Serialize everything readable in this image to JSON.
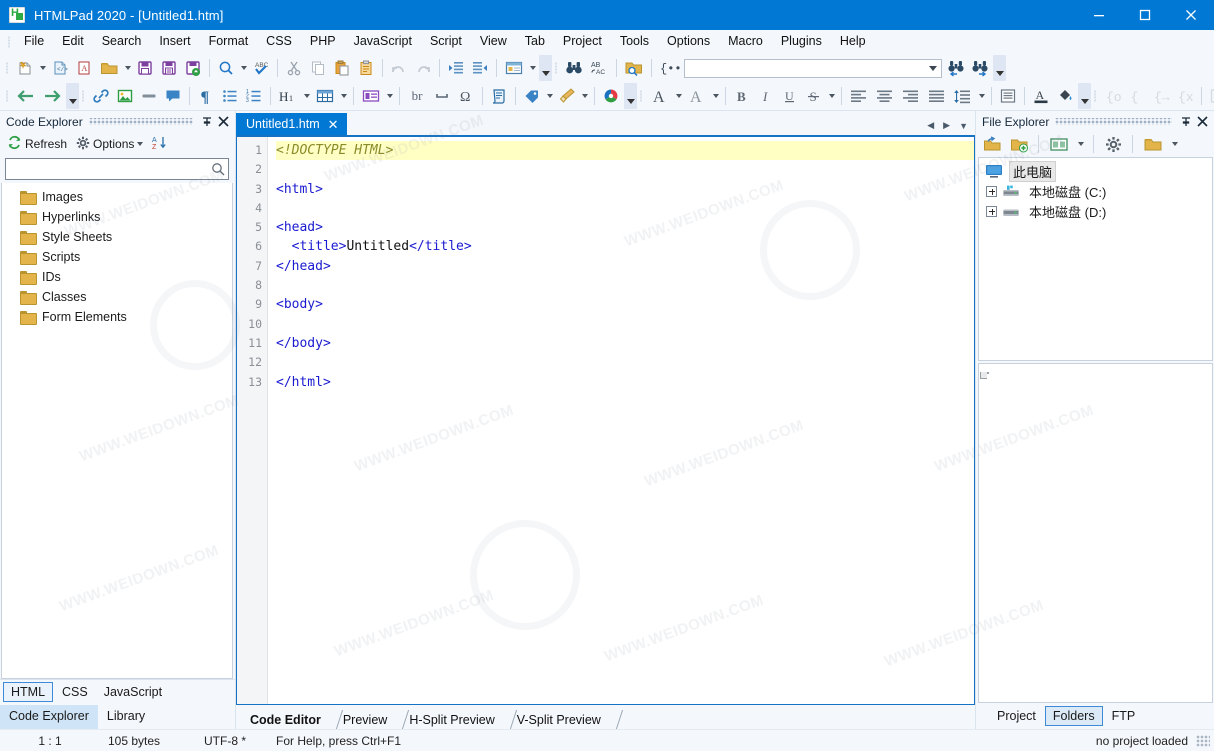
{
  "window": {
    "title": "HTMLPad 2020 - [Untitled1.htm]",
    "app_icon": "htmlpad-logo-icon",
    "minimize": "minimize-icon",
    "maximize": "maximize-icon",
    "close": "close-icon"
  },
  "menubar": [
    {
      "label": "File"
    },
    {
      "label": "Edit"
    },
    {
      "label": "Search"
    },
    {
      "label": "Insert"
    },
    {
      "label": "Format"
    },
    {
      "label": "CSS"
    },
    {
      "label": "PHP"
    },
    {
      "label": "JavaScript"
    },
    {
      "label": "Script"
    },
    {
      "label": "View"
    },
    {
      "label": "Tab"
    },
    {
      "label": "Project"
    },
    {
      "label": "Tools"
    },
    {
      "label": "Options"
    },
    {
      "label": "Macro"
    },
    {
      "label": "Plugins"
    },
    {
      "label": "Help"
    }
  ],
  "toolbar_row1": {
    "search_combo_value": "",
    "items": [
      "new-file-icon",
      "new-file-dropdown",
      "new-from-template-icon",
      "new-document-icon",
      "open-folder-icon",
      "open-dropdown",
      "save-icon",
      "save-as-icon",
      "save-upload-icon",
      "find-icon",
      "find-dropdown",
      "spell-check-icon",
      "cut-icon",
      "copy-icon",
      "paste-icon",
      "clipboard-icon",
      "undo-icon",
      "redo-icon",
      "indent-icon",
      "outdent-icon",
      "window-layout-icon",
      "window-layout-dropdown",
      "toolbar-overflow",
      "find-binoculars-icon",
      "replace-abac-icon",
      "find-in-files-icon",
      "insert-snippet-icon",
      "find-previous-icon",
      "find-next-icon",
      "toolbar-overflow"
    ]
  },
  "toolbar_row2": {
    "items": [
      "back-arrow-icon",
      "forward-arrow-icon",
      "toolbar-overflow",
      "link-icon",
      "image-icon",
      "horizontal-rule-icon",
      "comment-icon",
      "paragraph-icon",
      "bullet-list-icon",
      "numbered-list-icon",
      "heading-icon",
      "heading-dropdown",
      "table-icon",
      "table-dropdown",
      "form-icon",
      "form-dropdown",
      "line-break-icon",
      "nbsp-icon",
      "special-char-icon",
      "script-icon",
      "tag-icon",
      "tag-dropdown",
      "brush-icon",
      "brush-dropdown",
      "color-wheel-icon",
      "toolbar-overflow",
      "font-size-icon",
      "font-size-dropdown",
      "font-family-icon",
      "font-family-dropdown",
      "bold-icon",
      "italic-icon",
      "underline-icon",
      "strikethrough-icon",
      "strikethrough-dropdown",
      "align-left-icon",
      "align-center-icon",
      "align-right-icon",
      "align-justify-icon",
      "line-height-icon",
      "line-height-dropdown",
      "paragraph-block-icon",
      "font-color-icon",
      "fill-color-icon",
      "toolbar-overflow",
      "css-selector-icon",
      "css-block-icon",
      "css-arrow-icon",
      "css-close-icon",
      "box-model-icon",
      "shadow-icon",
      "css-validate-icon",
      "css-validate-red-icon",
      "toolbar-overflow"
    ],
    "br_label": "br"
  },
  "left_panel": {
    "title": "Code Explorer",
    "pin_icon": "pin-icon",
    "close_icon": "close-icon",
    "toolbar": {
      "refresh_label": "Refresh",
      "refresh_icon": "refresh-icon",
      "options_label": "Options",
      "options_icon": "gear-icon",
      "sort_icon": "sort-az-icon"
    },
    "search_placeholder": "",
    "search_value": "",
    "search_icon": "search-icon",
    "tree": [
      {
        "label": "Images",
        "icon": "folder-icon"
      },
      {
        "label": "Hyperlinks",
        "icon": "folder-icon"
      },
      {
        "label": "Style Sheets",
        "icon": "folder-icon"
      },
      {
        "label": "Scripts",
        "icon": "folder-icon"
      },
      {
        "label": "IDs",
        "icon": "folder-icon"
      },
      {
        "label": "Classes",
        "icon": "folder-icon"
      },
      {
        "label": "Form Elements",
        "icon": "folder-icon"
      }
    ],
    "lang_tabs": [
      {
        "label": "HTML",
        "selected": true
      },
      {
        "label": "CSS",
        "selected": false
      },
      {
        "label": "JavaScript",
        "selected": false
      }
    ],
    "dock_tabs": [
      {
        "label": "Code Explorer",
        "active": true
      },
      {
        "label": "Library",
        "active": false
      }
    ]
  },
  "editor": {
    "document_tab": {
      "label": "Untitled1.htm",
      "close_icon": "close-icon"
    },
    "tabstrip_nav": {
      "prev_icon": "chevron-left-icon",
      "next_icon": "chevron-right-icon",
      "list_icon": "chevron-down-icon"
    },
    "lines": [
      {
        "no": 1,
        "highlight": true,
        "tokens": [
          {
            "t": "doctype",
            "v": "<!DOCTYPE HTML>"
          }
        ]
      },
      {
        "no": 2,
        "highlight": false,
        "tokens": []
      },
      {
        "no": 3,
        "highlight": false,
        "tokens": [
          {
            "t": "tag",
            "v": "<html>"
          }
        ]
      },
      {
        "no": 4,
        "highlight": false,
        "tokens": []
      },
      {
        "no": 5,
        "highlight": false,
        "tokens": [
          {
            "t": "tag",
            "v": "<head>"
          }
        ]
      },
      {
        "no": 6,
        "highlight": false,
        "tokens": [
          {
            "t": "tag",
            "v": "  <title>"
          },
          {
            "t": "text",
            "v": "Untitled"
          },
          {
            "t": "tag",
            "v": "</title>"
          }
        ]
      },
      {
        "no": 7,
        "highlight": false,
        "tokens": [
          {
            "t": "tag",
            "v": "</head>"
          }
        ]
      },
      {
        "no": 8,
        "highlight": false,
        "tokens": []
      },
      {
        "no": 9,
        "highlight": false,
        "tokens": [
          {
            "t": "tag",
            "v": "<body>"
          }
        ]
      },
      {
        "no": 10,
        "highlight": false,
        "tokens": []
      },
      {
        "no": 11,
        "highlight": false,
        "tokens": [
          {
            "t": "tag",
            "v": "</body>"
          }
        ]
      },
      {
        "no": 12,
        "highlight": false,
        "tokens": []
      },
      {
        "no": 13,
        "highlight": false,
        "tokens": [
          {
            "t": "tag",
            "v": "</html>"
          }
        ]
      }
    ],
    "view_tabs": [
      {
        "label": "Code Editor",
        "active": true
      },
      {
        "label": "Preview",
        "active": false
      },
      {
        "label": "H-Split Preview",
        "active": false
      },
      {
        "label": "V-Split Preview",
        "active": false
      }
    ]
  },
  "right_panel": {
    "title": "File Explorer",
    "pin_icon": "pin-icon",
    "close_icon": "close-icon",
    "toolbar": [
      "folder-up-icon",
      "new-folder-icon",
      "view-mode-icon",
      "view-mode-dropdown",
      "settings-gear-icon",
      "open-folder-icon",
      "open-folder-dropdown"
    ],
    "tree": [
      {
        "label": "此电脑",
        "icon": "computer-icon",
        "selected": true,
        "expandable": false,
        "indent": 0
      },
      {
        "label": "本地磁盘 (C:)",
        "icon": "hard-drive-system-icon",
        "selected": false,
        "expandable": true,
        "indent": 1
      },
      {
        "label": "本地磁盘 (D:)",
        "icon": "hard-drive-icon",
        "selected": false,
        "expandable": true,
        "indent": 1
      }
    ],
    "preview_icon": "file-icon",
    "dock_tabs": [
      {
        "label": "Project",
        "selected": false
      },
      {
        "label": "Folders",
        "selected": true
      },
      {
        "label": "FTP",
        "selected": false
      }
    ]
  },
  "statusbar": {
    "cursor": "1 : 1",
    "size": "105 bytes",
    "encoding": "UTF-8 *",
    "hint": "For Help, press Ctrl+F1",
    "project": "no project loaded",
    "resize_grip": "resize-grip-icon"
  },
  "colors": {
    "titlebar": "#0078d4",
    "toolbar_bg": "#f4f7fb",
    "editor_border": "#1673c4",
    "highlight_line": "#ffffc4",
    "tag_color": "#1a1ad0",
    "doctype_color": "#8a8a2a",
    "folder_icon": "#e3b44a"
  },
  "watermarks": [
    "WWW.WEIDOWN.COM",
    "WWW.WEIDOWN.COM",
    "WWW.WEIDOWN.COM",
    "WWW.WEIDOWN.COM",
    "WWW.WEIDOWN.COM",
    "WWW.WEIDOWN.COM",
    "WWW.WEIDOWN.COM",
    "WWW.WEIDOWN.COM",
    "WWW.WEIDOWN.COM",
    "WWW.WEIDOWN.COM",
    "WWW.WEIDOWN.COM",
    "WWW.WEIDOWN.COM"
  ]
}
